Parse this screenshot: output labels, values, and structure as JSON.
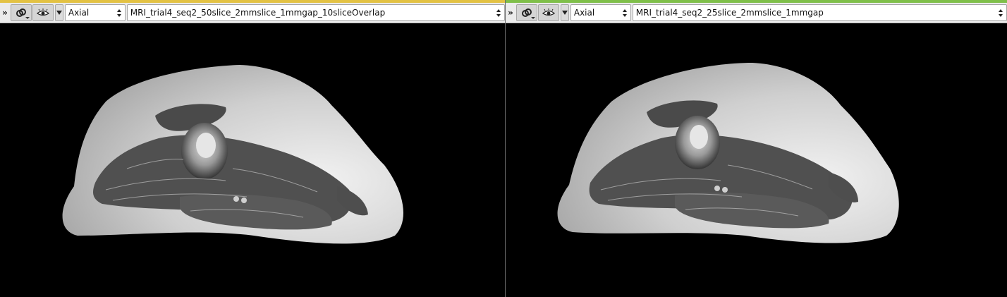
{
  "views": [
    {
      "strip_color": "#e3c244",
      "orientation": "Axial",
      "volume": "MRI_trial4_seq2_50slice_2mmslice_1mmgap_10sliceOverlap"
    },
    {
      "strip_color": "#7fbf4a",
      "orientation": "Axial",
      "volume": "MRI_trial4_seq2_25slice_2mmslice_1mmgap"
    }
  ],
  "icons": {
    "more": "double-chevron-icon",
    "link": "link-icon",
    "visibility": "eye-icon"
  }
}
